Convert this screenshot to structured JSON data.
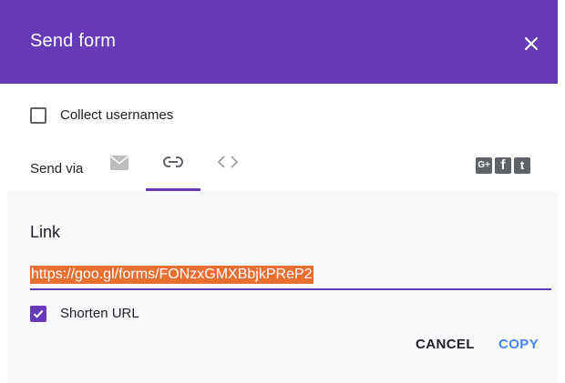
{
  "dialog": {
    "title": "Send form",
    "close_icon": "close-icon"
  },
  "collect": {
    "label": "Collect usernames",
    "checked": false
  },
  "send_via": {
    "label": "Send via",
    "tabs": [
      {
        "name": "email",
        "icon": "mail-icon",
        "selected": false
      },
      {
        "name": "link",
        "icon": "link-icon",
        "selected": true
      },
      {
        "name": "embed",
        "icon": "embed-code-icon",
        "selected": false
      }
    ],
    "social": [
      {
        "name": "google-plus",
        "glyph": "G+"
      },
      {
        "name": "facebook",
        "glyph": "f"
      },
      {
        "name": "twitter",
        "glyph": "t"
      }
    ]
  },
  "link_section": {
    "title": "Link",
    "url": "https://goo.gl/forms/FONzxGMXBbjkPReP2",
    "shorten_label": "Shorten URL",
    "shorten_checked": true
  },
  "actions": {
    "cancel": "CANCEL",
    "copy": "COPY"
  },
  "colors": {
    "header": "#673ab7",
    "accent": "#673ab7",
    "copy_button": "#4285f4",
    "url_highlight": "#e76f32"
  }
}
